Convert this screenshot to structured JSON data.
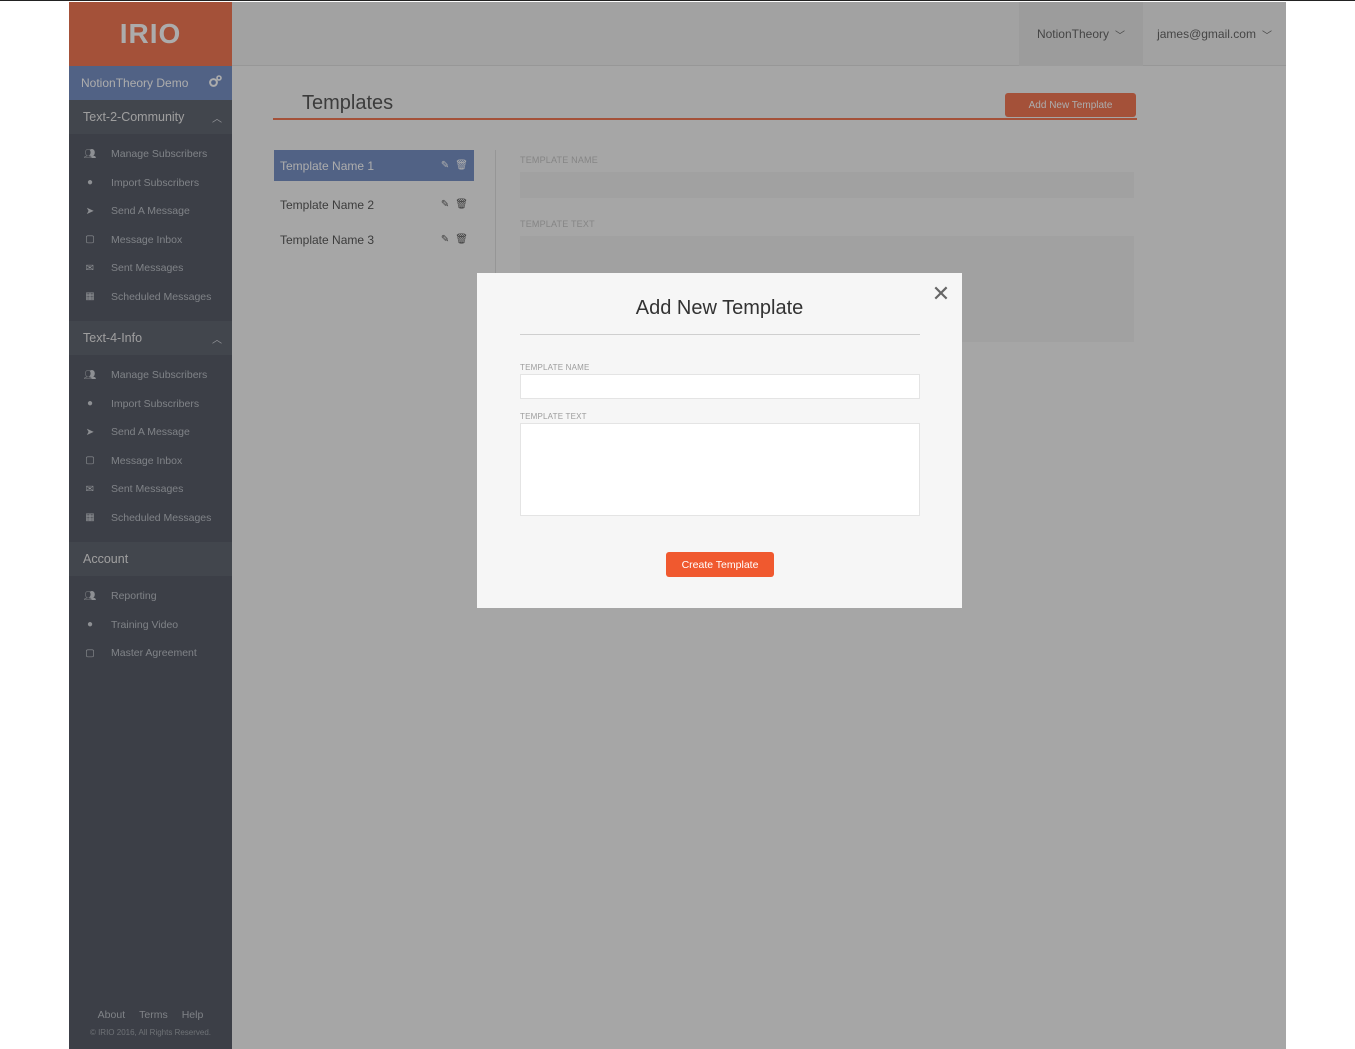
{
  "app": {
    "logo": "IRIO"
  },
  "header": {
    "org_dropdown": "NotionTheory",
    "user_dropdown": "james@gmail.com"
  },
  "sidebar": {
    "account_name": "NotionTheory Demo",
    "sections": [
      {
        "title": "Text-2-Community",
        "items": [
          {
            "label": "Manage Subscribers",
            "icon": "users-icon"
          },
          {
            "label": "Import Subscribers",
            "icon": "user-import-icon"
          },
          {
            "label": "Send A Message",
            "icon": "send-icon"
          },
          {
            "label": "Message Inbox",
            "icon": "inbox-icon"
          },
          {
            "label": "Sent Messages",
            "icon": "envelope-icon"
          },
          {
            "label": "Scheduled Messages",
            "icon": "calendar-icon"
          }
        ]
      },
      {
        "title": "Text-4-Info",
        "items": [
          {
            "label": "Manage Subscribers",
            "icon": "users-icon"
          },
          {
            "label": "Import Subscribers",
            "icon": "user-import-icon"
          },
          {
            "label": "Send A Message",
            "icon": "send-icon"
          },
          {
            "label": "Message Inbox",
            "icon": "inbox-icon"
          },
          {
            "label": "Sent Messages",
            "icon": "envelope-icon"
          },
          {
            "label": "Scheduled Messages",
            "icon": "calendar-icon"
          }
        ]
      },
      {
        "title": "Account",
        "items": [
          {
            "label": "Reporting",
            "icon": "users-icon"
          },
          {
            "label": "Training Video",
            "icon": "user-import-icon"
          },
          {
            "label": "Master Agreement",
            "icon": "inbox-icon"
          }
        ]
      }
    ],
    "footer": {
      "links": [
        "About",
        "Terms",
        "Help"
      ],
      "copyright": "© IRIO 2016, All Rights Reserved."
    }
  },
  "main": {
    "title": "Templates",
    "add_button": "Add New Template",
    "templates": [
      "Template Name 1",
      "Template Name 2",
      "Template Name 3"
    ],
    "editor": {
      "name_label": "TEMPLATE NAME",
      "text_label": "TEMPLATE TEXT"
    }
  },
  "modal": {
    "title": "Add New Template",
    "name_label": "TEMPLATE NAME",
    "name_value": "",
    "text_label": "TEMPLATE TEXT",
    "text_value": "",
    "submit": "Create Template"
  },
  "colors": {
    "accent": "#f0592f",
    "selected": "#5a78b8",
    "sidebar": "#343a47"
  }
}
